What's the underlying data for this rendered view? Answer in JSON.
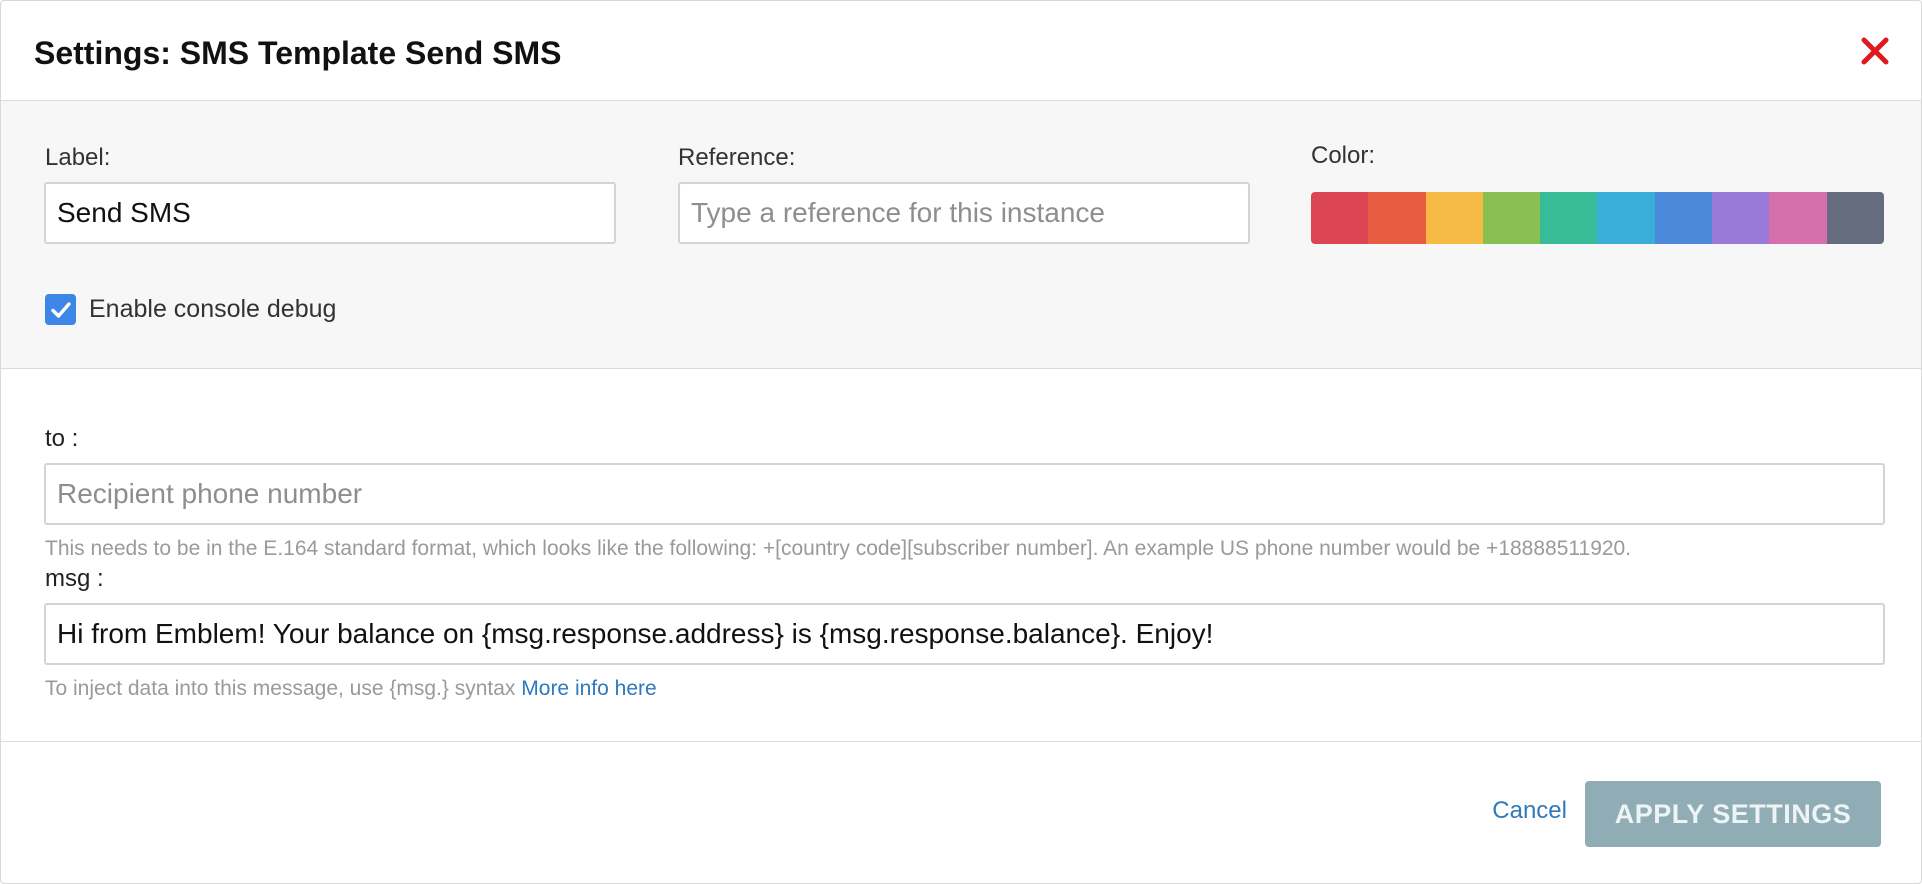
{
  "dialog": {
    "title": "Settings: SMS Template Send SMS"
  },
  "general": {
    "label_caption": "Label:",
    "label_value": "Send SMS",
    "reference_caption": "Reference:",
    "reference_placeholder": "Type a reference for this instance",
    "reference_value": "",
    "color_caption": "Color:",
    "colors": [
      "#dc4654",
      "#e85c42",
      "#f6bb45",
      "#8ac052",
      "#38bc98",
      "#3badd9",
      "#4b89db",
      "#9979da",
      "#d570ad",
      "#656d7e"
    ],
    "debug_label": "Enable console debug",
    "debug_checked": true
  },
  "params": {
    "to": {
      "caption": "to :",
      "placeholder": "Recipient phone number",
      "value": "",
      "help": "This needs to be in the E.164 standard format, which looks like the following: +[country code][subscriber number]. An example US phone number would be +18888511920."
    },
    "msg": {
      "caption": "msg :",
      "value": "Hi from Emblem! Your balance on {msg.response.address} is {msg.response.balance}. Enjoy!",
      "help": "To inject data into this message, use {msg.} syntax",
      "help_link": "More info here"
    }
  },
  "footer": {
    "cancel_label": "Cancel",
    "apply_label": "APPLY SETTINGS"
  },
  "icons": {
    "close": "close-icon",
    "check": "checkmark-icon"
  },
  "accent_colors": {
    "close": "#e0191e",
    "link": "#2f79bd",
    "checkbox": "#3d86e8",
    "apply_button": "#90adb6"
  }
}
